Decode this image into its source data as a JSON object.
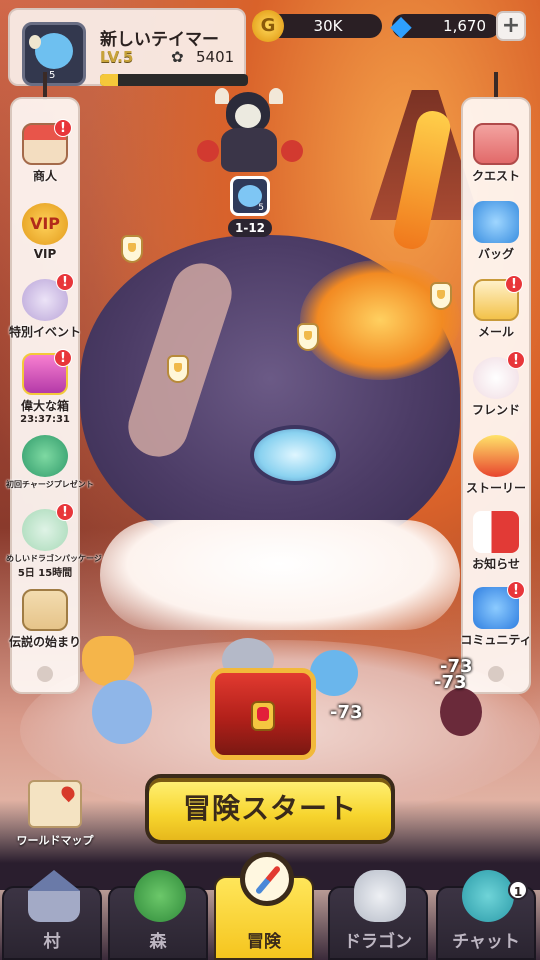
{
  "player": {
    "name": "新しいテイマー",
    "level": "LV.5",
    "power": "5401",
    "avatar_level": "5",
    "xp_fraction": 0.12
  },
  "currency": {
    "coin_symbol": "G",
    "coins": "30K",
    "gems": "1,670",
    "gem_icon": "◆",
    "plus_icon": "+"
  },
  "stage": {
    "label": "1-12",
    "portrait_level": "5"
  },
  "left_menu": [
    {
      "label": "商人",
      "alert": "!",
      "icon": "shop-stall-icon"
    },
    {
      "label": "VIP",
      "alert": "",
      "icon": "vip-badge-icon",
      "icon_text": "VIP"
    },
    {
      "label": "特別イベント",
      "alert": "!",
      "icon": "event-girl-icon"
    },
    {
      "label": "偉大な箱",
      "alert": "!",
      "icon": "treasure-box-icon",
      "timer": "23:37:31"
    },
    {
      "label": "初回チャージプレゼント",
      "alert": "",
      "icon": "dragon-gift-icon"
    },
    {
      "label": "めしいドラゴンパッケージ",
      "alert": "!",
      "icon": "dragon-package-icon",
      "timer": "5日 15時間"
    },
    {
      "label": "伝説の始まり",
      "alert": "",
      "icon": "legend-calendar-icon"
    }
  ],
  "right_menu": [
    {
      "label": "クエスト",
      "alert": "",
      "icon": "quest-scroll-icon"
    },
    {
      "label": "バッグ",
      "alert": "",
      "icon": "bag-icon"
    },
    {
      "label": "メール",
      "alert": "!",
      "icon": "mail-icon"
    },
    {
      "label": "フレンド",
      "alert": "!",
      "icon": "friend-cat-icon"
    },
    {
      "label": "ストーリー",
      "alert": "",
      "icon": "story-book-icon"
    },
    {
      "label": "お知らせ",
      "alert": "",
      "icon": "megaphone-icon"
    },
    {
      "label": "コミュニティ",
      "alert": "!",
      "icon": "community-chat-icon"
    }
  ],
  "worldmap": {
    "label": "ワールドマップ"
  },
  "start_button": "冒険スタート",
  "damage": [
    "-73",
    "-73",
    "-73"
  ],
  "nav": [
    {
      "label": "村",
      "icon": "village-house-icon"
    },
    {
      "label": "森",
      "icon": "forest-tree-icon"
    },
    {
      "label": "冒険",
      "icon": "compass-icon"
    },
    {
      "label": "ドラゴン",
      "icon": "dragon-head-icon"
    },
    {
      "label": "チャット",
      "icon": "chat-bubble-icon",
      "badge": "1"
    }
  ]
}
